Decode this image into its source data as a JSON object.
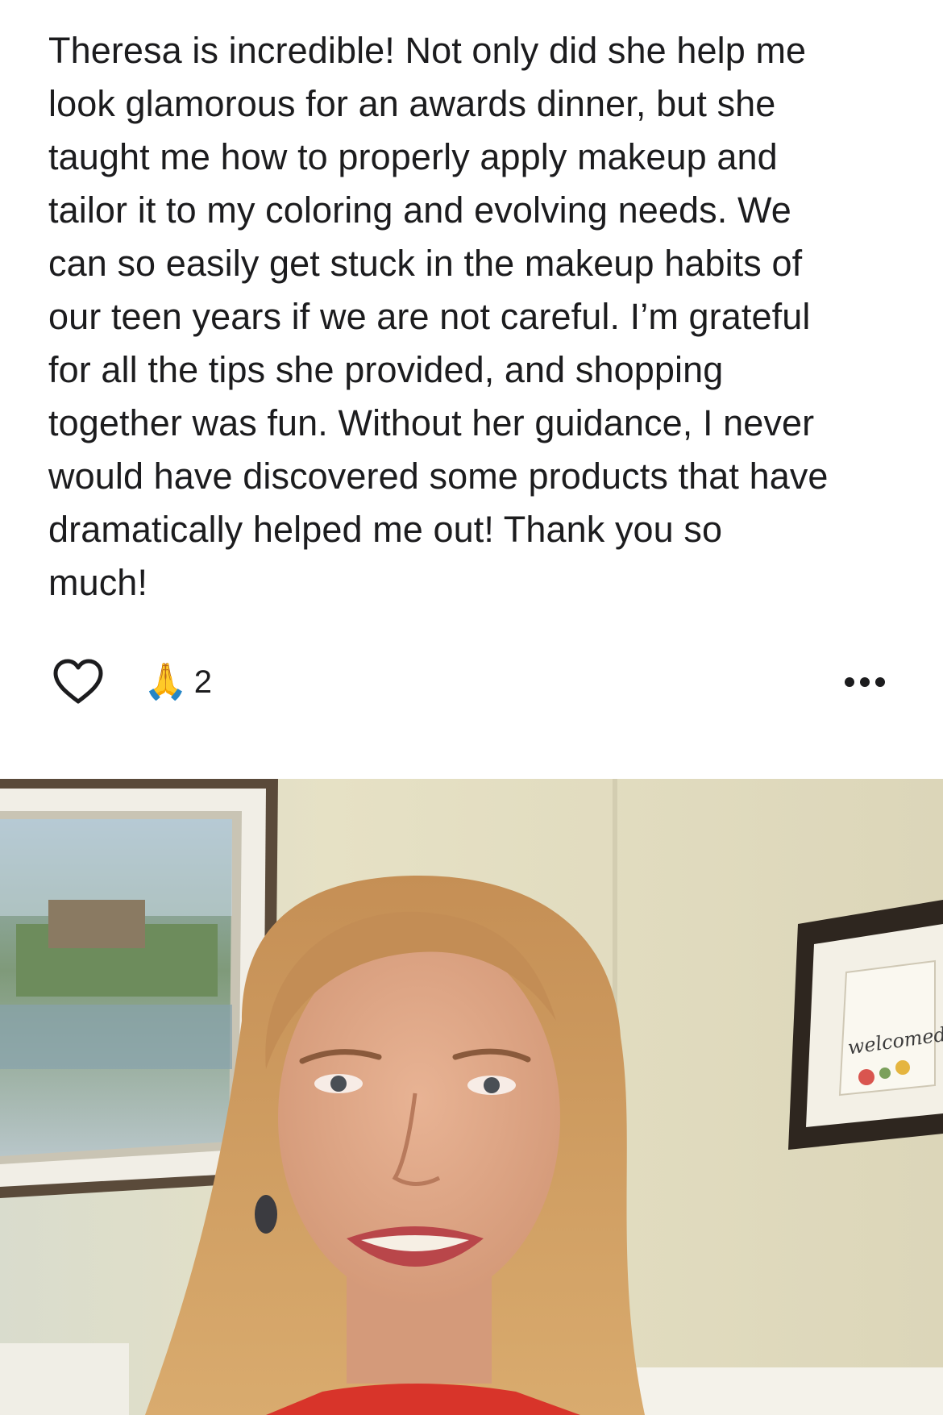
{
  "post": {
    "lines": [
      "Theresa is incredible! Not only did she help me",
      "look glamorous for an awards dinner, but she",
      "taught me how to properly apply makeup and",
      "tailor it to my coloring and evolving needs. We",
      "can so easily get stuck in the makeup habits of",
      "our teen years if we are not careful. I’m grateful",
      "for all the tips she provided, and shopping",
      "together was fun. Without her guidance, I never",
      "would have discovered some products that have",
      "dramatically helped me out! Thank you so",
      "much!"
    ]
  },
  "actions": {
    "like_icon": "heart-outline-icon",
    "reaction_emoji": "🙏",
    "reaction_count": "2",
    "more_icon": "ellipsis-icon"
  },
  "photo": {
    "frame_art_text": "welcomed"
  },
  "colors": {
    "text": "#1c1c1e",
    "background": "#ffffff",
    "wall": "#e4dfc6",
    "hair": "#c99a5e",
    "shirt": "#d8342a"
  }
}
